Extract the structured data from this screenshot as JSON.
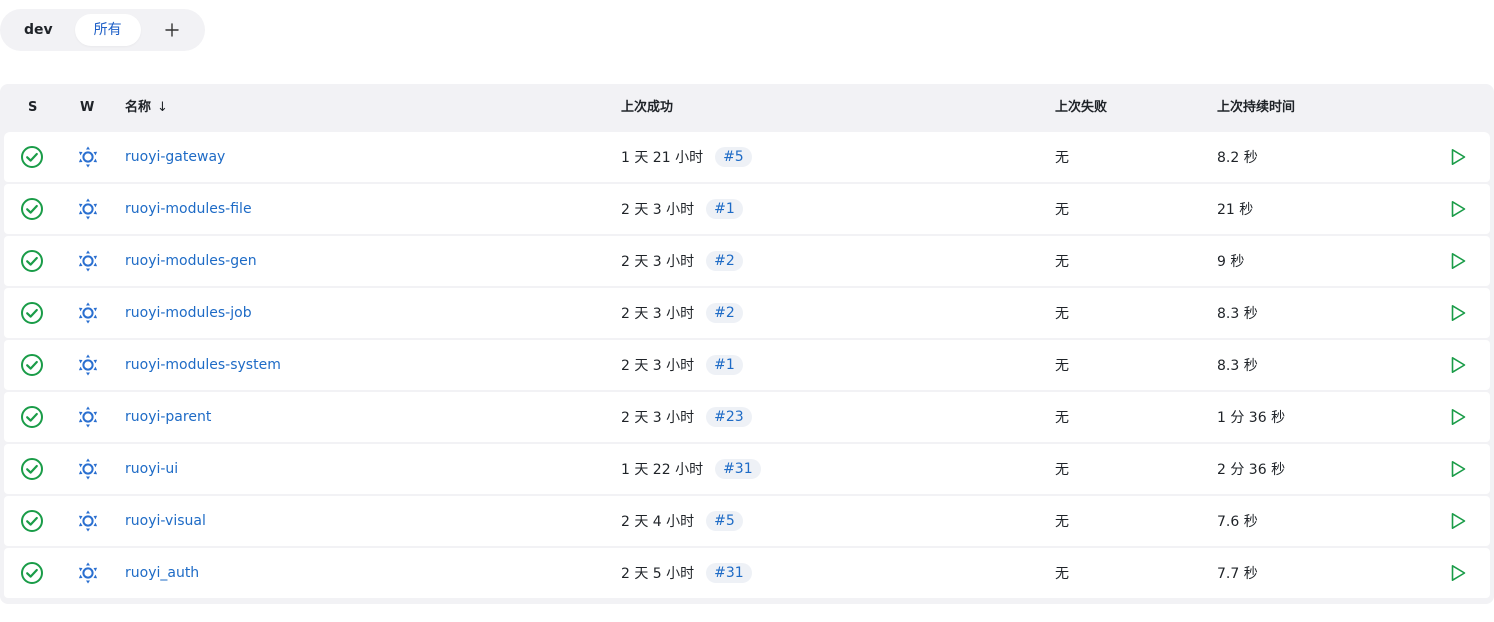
{
  "tabs": {
    "dev": "dev",
    "all": "所有",
    "add": "+"
  },
  "table": {
    "headers": {
      "s": "S",
      "w": "W",
      "name": "名称",
      "sort_arrow": "↓",
      "last_success": "上次成功",
      "last_failure": "上次失败",
      "last_duration": "上次持续时间"
    },
    "rows": [
      {
        "name": "ruoyi-gateway",
        "last_success": "1 天 21 小时",
        "build": "#5",
        "last_failure": "无",
        "duration": "8.2 秒"
      },
      {
        "name": "ruoyi-modules-file",
        "last_success": "2 天 3 小时",
        "build": "#1",
        "last_failure": "无",
        "duration": "21 秒"
      },
      {
        "name": "ruoyi-modules-gen",
        "last_success": "2 天 3 小时",
        "build": "#2",
        "last_failure": "无",
        "duration": "9 秒"
      },
      {
        "name": "ruoyi-modules-job",
        "last_success": "2 天 3 小时",
        "build": "#2",
        "last_failure": "无",
        "duration": "8.3 秒"
      },
      {
        "name": "ruoyi-modules-system",
        "last_success": "2 天 3 小时",
        "build": "#1",
        "last_failure": "无",
        "duration": "8.3 秒"
      },
      {
        "name": "ruoyi-parent",
        "last_success": "2 天 3 小时",
        "build": "#23",
        "last_failure": "无",
        "duration": "1 分 36 秒"
      },
      {
        "name": "ruoyi-ui",
        "last_success": "1 天 22 小时",
        "build": "#31",
        "last_failure": "无",
        "duration": "2 分 36 秒"
      },
      {
        "name": "ruoyi-visual",
        "last_success": "2 天 4 小时",
        "build": "#5",
        "last_failure": "无",
        "duration": "7.6 秒"
      },
      {
        "name": "ruoyi_auth",
        "last_success": "2 天 5 小时",
        "build": "#31",
        "last_failure": "无",
        "duration": "7.7 秒"
      }
    ]
  },
  "icons": {
    "status": "success-check-icon",
    "weather": "sunny-weather-icon",
    "run": "play-icon",
    "add": "plus-icon"
  },
  "colors": {
    "success_green": "#1a9c48",
    "link_blue": "#1e6bc6",
    "weather_blue": "#2a6fd0",
    "header_bg": "#f2f2f5"
  }
}
